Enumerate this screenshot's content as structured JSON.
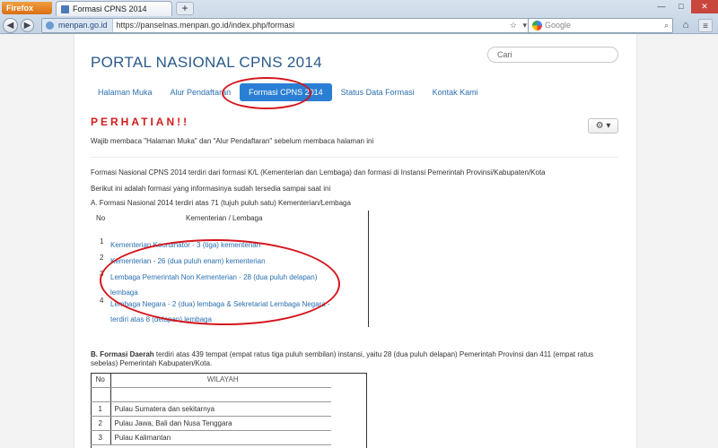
{
  "browser": {
    "app_button": "Firefox",
    "tab_title": "Formasi CPNS 2014",
    "new_tab": "+",
    "url_site": "menpan.go.id",
    "url": "https://panselnas.menpan.go.id/index.php/formasi",
    "search_placeholder": "Google"
  },
  "site": {
    "title": "PORTAL NASIONAL CPNS 2014",
    "search_placeholder": "Cari",
    "nav": [
      "Halaman Muka",
      "Alur Pendaftaran",
      "Formasi CPNS 2014",
      "Status Data Formasi",
      "Kontak Kami"
    ],
    "active_nav_index": 2
  },
  "notice": {
    "heading": "PERHATIAN!!",
    "text": "Wajib membaca \"Halaman Muka\" dan \"Alur Pendaftaran\" sebelum membaca halaman ini",
    "gear": "⚙ ▾"
  },
  "body": {
    "p1": "Formasi Nasional CPNS 2014 terdiri dari formasi K/L (Kementerian dan Lembaga) dan formasi di Instansi Pemerintah Provinsi/Kabupaten/Kota",
    "p2": "Berikut ini adalah formasi yang informasinya sudah tersedia sampai saat ini",
    "p3": "A. Formasi Nasional 2014 terdiri atas 71 (tujuh puluh satu) Kementerian/Lembaga"
  },
  "table1": {
    "headers": [
      "No",
      "Kementerian / Lembaga"
    ],
    "rows": [
      {
        "no": "1",
        "text": "Kementerian Koordinator - 3 (tiga) kementerian"
      },
      {
        "no": "2",
        "text": "Kementerian - 26 (dua puluh enam) kementerian"
      },
      {
        "no": "3",
        "text": "Lembaga Pemerintah Non Kementerian - 28 (dua puluh delapan) lembaga"
      },
      {
        "no": "4",
        "text": "Lembaga Negara - 2 (dua) lembaga & Sekretariat Lembaga Negara - terdiri atas 8 (delapan) lembaga"
      }
    ]
  },
  "daerah": {
    "label": "B. Formasi Daerah",
    "text": " terdiri atas 439 tempat (empat ratus tiga puluh sembilan) instansi, yaitu 28 (dua puluh delapan) Pemerintah Provinsi dan 411 (empat ratus sebelas) Pemerintah Kabupaten/Kota."
  },
  "table2": {
    "headers": [
      "No",
      "WILAYAH"
    ],
    "rows": [
      {
        "no": "1",
        "text": "Pulau Sumatera dan sekitarnya"
      },
      {
        "no": "2",
        "text": "Pulau Jawa, Bali dan Nusa Tenggara"
      },
      {
        "no": "3",
        "text": "Pulau Kalimantan"
      }
    ]
  },
  "colors": {
    "accent": "#2a7fd4",
    "annotation": "#d4151c",
    "warning": "#d21c1c"
  }
}
